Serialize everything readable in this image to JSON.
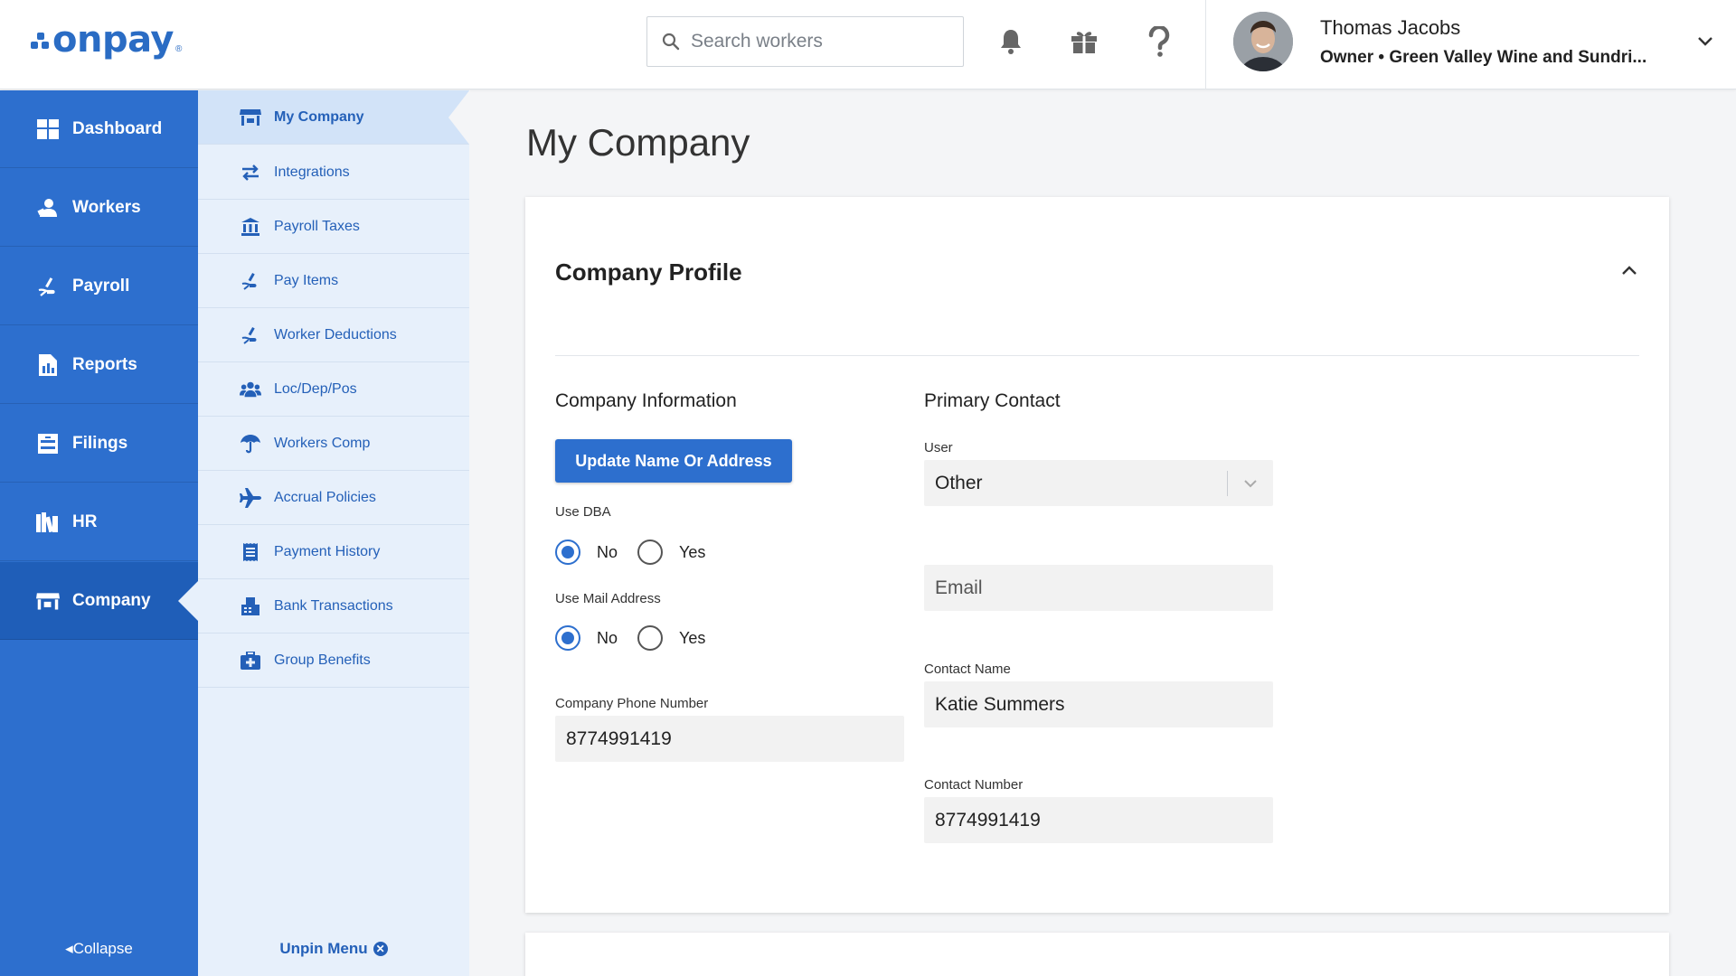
{
  "header": {
    "logo_text": "onpay",
    "logo_reg": "®",
    "search_placeholder": "Search workers",
    "user_name": "Thomas Jacobs",
    "user_sub": "Owner • Green Valley Wine and Sundri..."
  },
  "sidebar": {
    "items": [
      {
        "label": "Dashboard",
        "icon": "dashboard-icon"
      },
      {
        "label": "Workers",
        "icon": "worker-icon"
      },
      {
        "label": "Payroll",
        "icon": "payroll-icon"
      },
      {
        "label": "Reports",
        "icon": "reports-icon"
      },
      {
        "label": "Filings",
        "icon": "filings-icon"
      },
      {
        "label": "HR",
        "icon": "hr-icon"
      },
      {
        "label": "Company",
        "icon": "company-icon"
      }
    ],
    "active": "Company",
    "collapse_label": "Collapse"
  },
  "subnav": {
    "items": [
      {
        "label": "My Company",
        "icon": "store-icon"
      },
      {
        "label": "Integrations",
        "icon": "swap-arrows-icon"
      },
      {
        "label": "Payroll Taxes",
        "icon": "bank-icon"
      },
      {
        "label": "Pay Items",
        "icon": "hand-money-icon"
      },
      {
        "label": "Worker Deductions",
        "icon": "hand-money-icon"
      },
      {
        "label": "Loc/Dep/Pos",
        "icon": "users-icon"
      },
      {
        "label": "Workers Comp",
        "icon": "umbrella-icon"
      },
      {
        "label": "Accrual Policies",
        "icon": "airplane-icon"
      },
      {
        "label": "Payment History",
        "icon": "receipt-icon"
      },
      {
        "label": "Bank Transactions",
        "icon": "fax-icon"
      },
      {
        "label": "Group Benefits",
        "icon": "medical-kit-icon"
      }
    ],
    "active": "My Company",
    "unpin_label": "Unpin Menu"
  },
  "main": {
    "page_title": "My Company",
    "card_title": "Company Profile",
    "company_info": {
      "heading": "Company Information",
      "update_button": "Update Name Or Address",
      "use_dba_label": "Use DBA",
      "use_dba_value": "No",
      "use_mail_label": "Use Mail Address",
      "use_mail_value": "No",
      "radio_no": "No",
      "radio_yes": "Yes",
      "phone_label": "Company Phone Number",
      "phone_value": "8774991419"
    },
    "primary_contact": {
      "heading": "Primary Contact",
      "user_label": "User",
      "user_value": "Other",
      "email_placeholder": "Email",
      "contact_name_label": "Contact Name",
      "contact_name_value": "Katie Summers",
      "contact_number_label": "Contact Number",
      "contact_number_value": "8774991419"
    }
  },
  "colors": {
    "brand": "#2d6fce",
    "sidebar_active": "#1f5eb8",
    "subnav_bg": "#e7f0fb",
    "link": "#2460b8"
  }
}
